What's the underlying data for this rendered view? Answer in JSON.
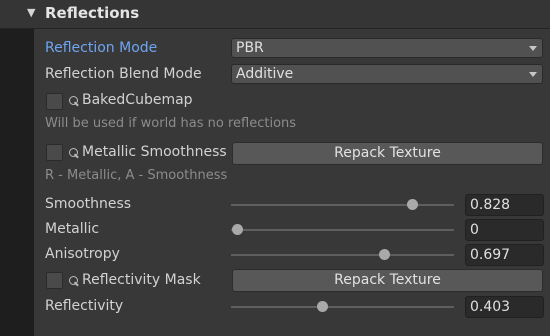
{
  "section": {
    "title": "Reflections",
    "expand_icon": "triangle-down-icon"
  },
  "reflection_mode": {
    "label": "Reflection Mode",
    "value": "PBR"
  },
  "reflection_blend_mode": {
    "label": "Reflection Blend Mode",
    "value": "Additive"
  },
  "baked_cubemap": {
    "label": "BakedCubemap",
    "checked": false,
    "hint": "Will be used if world has no reflections",
    "icon": "texture-slot-icon"
  },
  "metallic_smoothness": {
    "label": "Metallic Smoothness",
    "checked": false,
    "button": "Repack Texture",
    "hint": "R - Metallic, A - Smoothness",
    "icon": "texture-slot-icon"
  },
  "sliders": [
    {
      "label": "Smoothness",
      "value": "0.828",
      "fraction": 0.828
    },
    {
      "label": "Metallic",
      "value": "0",
      "fraction": 0
    },
    {
      "label": "Anisotropy",
      "value": "0.697",
      "fraction": 0.697
    }
  ],
  "reflectivity_mask": {
    "label": "Reflectivity Mask",
    "checked": false,
    "button": "Repack Texture",
    "icon": "texture-slot-icon"
  },
  "reflectivity": {
    "label": "Reflectivity",
    "value": "0.403",
    "fraction": 0.403
  },
  "colors": {
    "accent_label": "#6ea5f0",
    "panel_bg": "#383838",
    "header_bg": "#353535"
  }
}
